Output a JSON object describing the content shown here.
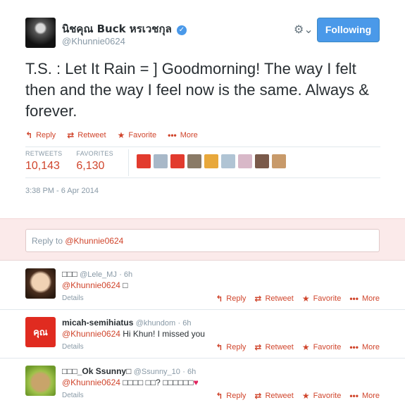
{
  "tweet": {
    "fullname": "นิชคุณ Buck หรเวชกุล",
    "username": "@Khunnie0624",
    "follow_label": "Following",
    "text": "T.S. : Let It Rain = ] Goodmorning! The way I felt then and the way I feel now is the same. Always & forever.",
    "actions": {
      "reply": "Reply",
      "retweet": "Retweet",
      "favorite": "Favorite",
      "more": "More"
    },
    "stats": {
      "retweets_label": "RETWEETS",
      "retweets": "10,143",
      "favorites_label": "FAVORITES",
      "favorites": "6,130"
    },
    "timestamp": "3:38 PM - 6 Apr 2014"
  },
  "reply_box": {
    "prefix": "Reply to",
    "mention": "@Khunnie0624"
  },
  "replies": [
    {
      "name": "□□□",
      "username": "@Lele_MJ",
      "time": "· 6h",
      "mention": "@Khunnie0624",
      "text": "□",
      "details": "Details"
    },
    {
      "name": "micah-semihiatus",
      "username": "@khundom",
      "time": "· 6h",
      "mention": "@Khunnie0624",
      "text": "Hi Khun! I missed you",
      "details": "Details"
    },
    {
      "name": "□□□_Ok Ssunny□",
      "username": "@Ssunny_10",
      "time": "· 6h",
      "mention": "@Khunnie0624",
      "text": "□□□□ □□? □□□□□□",
      "heart": "♥",
      "details": "Details"
    }
  ],
  "colors": {
    "accent": "#d0452c",
    "follow_button": "#4a99e9",
    "reply_bg": "#fbeaea"
  }
}
